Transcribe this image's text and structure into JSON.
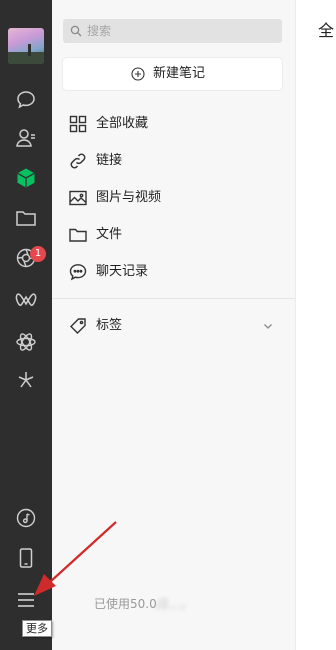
{
  "search": {
    "placeholder": "搜索"
  },
  "new_note": {
    "label": "新建笔记"
  },
  "nav_items": [
    {
      "label": "全部收藏",
      "icon": "grid-icon"
    },
    {
      "label": "链接",
      "icon": "link-icon"
    },
    {
      "label": "图片与视频",
      "icon": "image-icon"
    },
    {
      "label": "文件",
      "icon": "folder-icon"
    },
    {
      "label": "聊天记录",
      "icon": "chat-record-icon"
    }
  ],
  "tags": {
    "label": "标签"
  },
  "rail": {
    "badge_count": "1",
    "icons": [
      "chat-icon",
      "contacts-icon",
      "favorites-cube-icon",
      "files-folder-icon",
      "moments-aperture-icon",
      "channels-icon",
      "miniprogram-icon",
      "search-star-icon",
      "music-icon",
      "phone-icon",
      "menu-icon"
    ]
  },
  "footer": {
    "usage_text": "已使用50.0",
    "usage_blurred": "/2…，"
  },
  "right": {
    "title": "全"
  },
  "tooltip": {
    "label": "更多"
  },
  "colors": {
    "accent_green": "#07c160",
    "badge_red": "#e5484d",
    "annotation_arrow": "#d12a2a"
  }
}
